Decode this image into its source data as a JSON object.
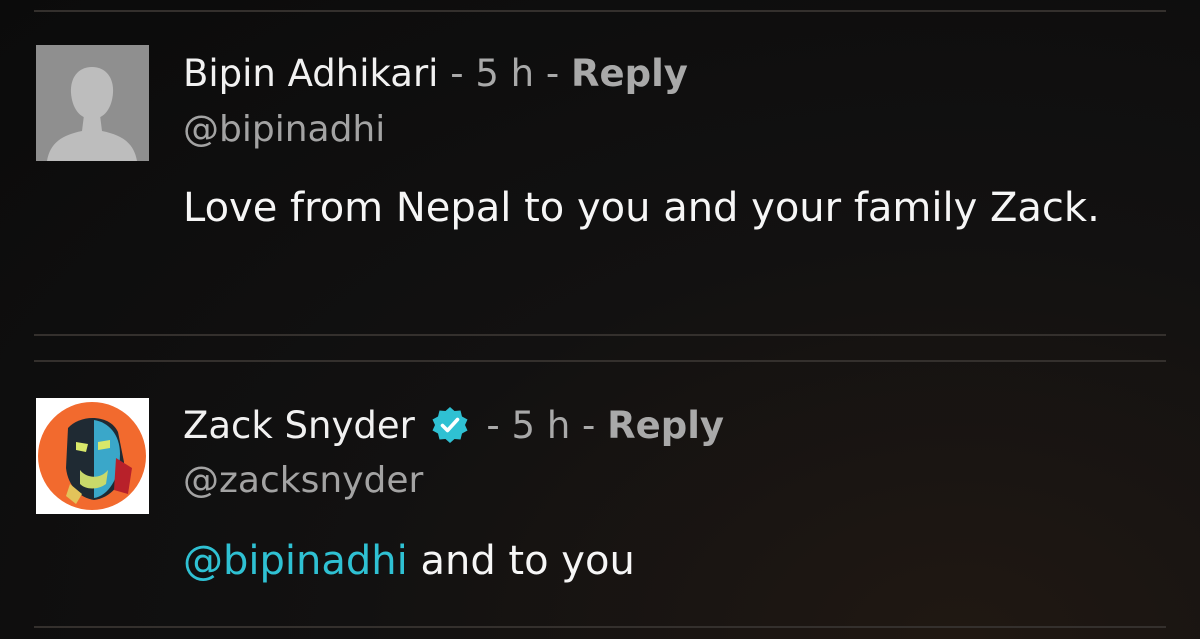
{
  "comments": [
    {
      "author": "Bipin Adhikari",
      "separator": "-",
      "time": "5 h",
      "reply_label": "Reply",
      "handle": "@bipinadhi",
      "body": "Love from Nepal to you and your family Zack.",
      "avatar": "default-person-icon",
      "verified": false
    },
    {
      "author": "Zack Snyder",
      "separator": "-",
      "time": "5 h",
      "reply_label": "Reply",
      "handle": "@zacksnyder",
      "mention": "@bipinadhi",
      "body": "and to you",
      "avatar": "illustrated-face-avatar",
      "verified": true
    }
  ],
  "colors": {
    "mention": "#2fc1d3",
    "verified": "#2fc1d3",
    "divider": "#34302d",
    "muted": "#a9a9a9"
  }
}
